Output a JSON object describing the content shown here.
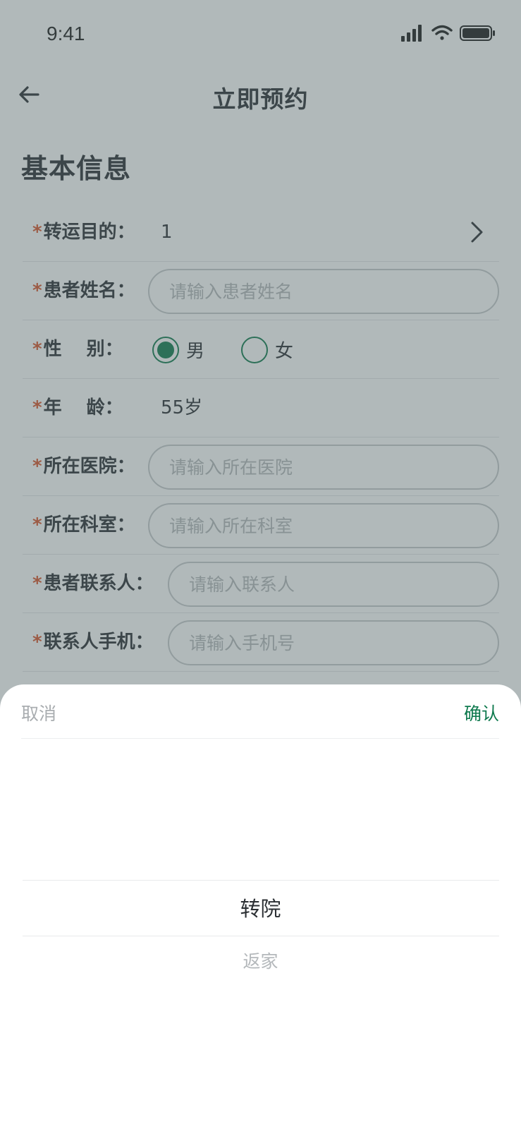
{
  "status_bar": {
    "time": "9:41"
  },
  "nav": {
    "title": "立即预约"
  },
  "section": {
    "title": "基本信息"
  },
  "form": {
    "purpose": {
      "label": "转运目的：",
      "value": "1"
    },
    "patient_name": {
      "label": "患者姓名：",
      "placeholder": "请输入患者姓名"
    },
    "gender": {
      "label": "性　 别：",
      "options": [
        "男",
        "女"
      ],
      "selected": "男"
    },
    "age": {
      "label": "年　 龄：",
      "value": "55岁"
    },
    "hospital": {
      "label": "所在医院：",
      "placeholder": "请输入所在医院"
    },
    "department": {
      "label": "所在科室：",
      "placeholder": "请输入所在科室"
    },
    "contact": {
      "label": "患者联系人：",
      "placeholder": "请输入联系人"
    },
    "contact_phone": {
      "label": "联系人手机：",
      "placeholder": "请输入手机号"
    }
  },
  "picker": {
    "cancel_label": "取消",
    "confirm_label": "确认",
    "options": [
      "转院",
      "返家"
    ],
    "selected": "转院"
  },
  "colors": {
    "accent": "#0f7a4e",
    "required": "#d9542b",
    "overlay": "#526366"
  },
  "icons": {
    "back": "back-arrow-icon",
    "chevron": "chevron-right-icon",
    "signal": "signal-icon",
    "wifi": "wifi-icon",
    "battery": "battery-icon"
  }
}
